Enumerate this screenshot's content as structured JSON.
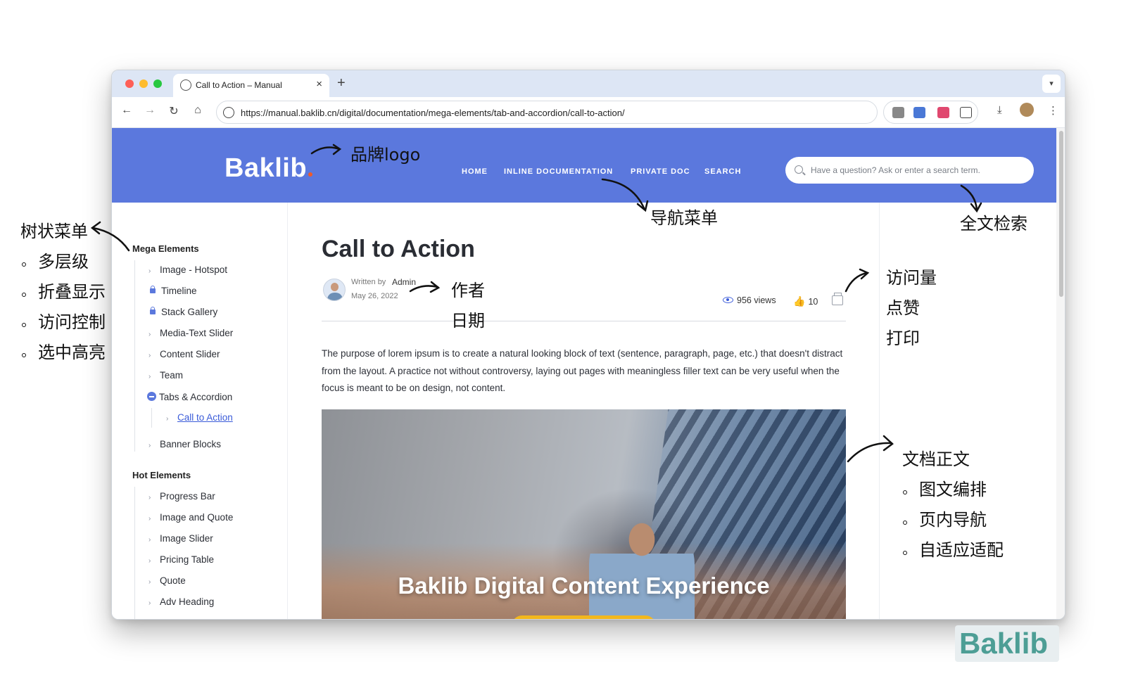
{
  "browser": {
    "tab_title": "Call to Action – Manual",
    "url": "https://manual.baklib.cn/digital/documentation/mega-elements/tab-and-accordion/call-to-action/"
  },
  "site": {
    "logo": "Baklib",
    "nav": [
      "HOME",
      "INLINE DOCUMENTATION",
      "PRIVATE DOC",
      "SEARCH"
    ],
    "search_placeholder": "Have a question? Ask or enter a search term."
  },
  "sidebar": {
    "groups": [
      {
        "title": "Mega Elements",
        "items": [
          {
            "label": "Image - Hotspot",
            "icon": "chevron-right-icon"
          },
          {
            "label": "Timeline",
            "icon": "lock-icon"
          },
          {
            "label": "Stack Gallery",
            "icon": "lock-icon"
          },
          {
            "label": "Media-Text Slider",
            "icon": "chevron-right-icon"
          },
          {
            "label": "Content Slider",
            "icon": "chevron-right-icon"
          },
          {
            "label": "Team",
            "icon": "chevron-right-icon"
          },
          {
            "label": "Tabs & Accordion",
            "icon": "minus-circle-icon",
            "children": [
              {
                "label": "Call to Action",
                "icon": "chevron-right-icon",
                "active": true
              }
            ]
          },
          {
            "label": "Banner Blocks",
            "icon": "chevron-right-icon"
          }
        ]
      },
      {
        "title": "Hot Elements",
        "items": [
          {
            "label": "Progress Bar"
          },
          {
            "label": "Image and Quote"
          },
          {
            "label": "Image Slider"
          },
          {
            "label": "Pricing Table"
          },
          {
            "label": "Quote"
          },
          {
            "label": "Adv Heading"
          }
        ]
      }
    ]
  },
  "article": {
    "title": "Call to Action",
    "written_by": "Written by",
    "author": "Admin",
    "date": "May 26, 2022",
    "views": "956 views",
    "likes": "10",
    "body": "The purpose of lorem ipsum is to create a natural looking block of text (sentence, paragraph, page, etc.) that doesn't distract from the layout. A practice not without controversy, laying out pages with meaningless filler text can be very useful when the focus is meant to be on design, not content.",
    "hero_title": "Baklib Digital Content Experience"
  },
  "annotations": {
    "brand_logo": "品牌logo",
    "nav_menu": "导航菜单",
    "fulltext_search": "全文检索",
    "tree_menu": "树状菜单",
    "tree_points": [
      "多层级",
      "折叠显示",
      "访问控制",
      "选中高亮"
    ],
    "author": "作者",
    "date": "日期",
    "stats": [
      "访问量",
      "点赞",
      "打印"
    ],
    "doc_body": "文档正文",
    "doc_points": [
      "图文编排",
      "页内导航",
      "自适应适配"
    ]
  },
  "watermark": "Baklib",
  "colors": {
    "header_blue": "#5b78dd",
    "accent_blue": "#3a5bd9",
    "logo_dot": "#f05a28",
    "hero_button": "#f3b71c"
  }
}
